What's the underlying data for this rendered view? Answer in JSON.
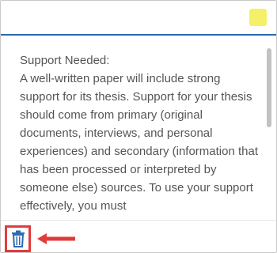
{
  "note": {
    "swatch_color": "#f5f06a",
    "accent_color": "#2b6cb3",
    "text": "Support Needed:\nA well-written paper will include strong support for its thesis. Support for your thesis should come from primary (original documents, interviews, and personal experiences) and secondary (information that has been processed or interpreted by someone else) sources. To use your support effectively, you must"
  },
  "footer": {
    "delete_icon": "trash-icon",
    "highlight_color": "#e23b3b"
  }
}
